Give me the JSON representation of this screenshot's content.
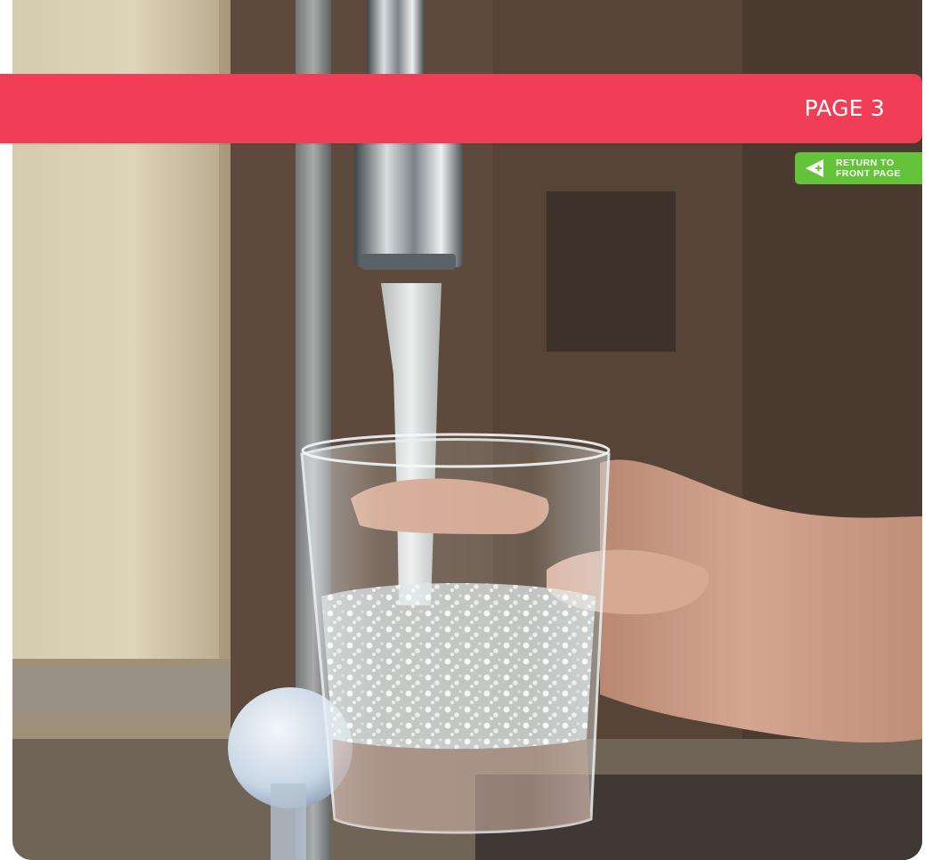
{
  "banner": {
    "page_label": "PAGE 3",
    "color": "#ef3e55"
  },
  "return_button": {
    "line_1": "RETURN TO",
    "line_2": "FRONT PAGE",
    "color": "#65c33a",
    "icon": "arrow-left-plus-icon"
  },
  "hero": {
    "subject": "water-glass-under-tap"
  }
}
